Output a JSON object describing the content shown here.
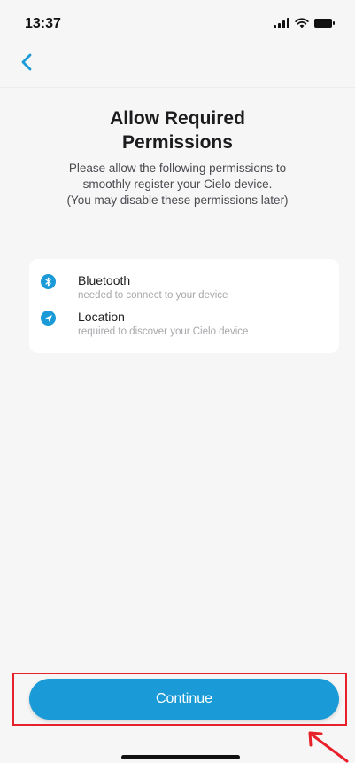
{
  "status_bar": {
    "time": "13:37",
    "icons": [
      "cellular-signal-icon",
      "wifi-icon",
      "battery-icon"
    ]
  },
  "nav": {
    "back_icon": "chevron-left-icon"
  },
  "header": {
    "title_line1": "Allow Required",
    "title_line2": "Permissions",
    "subtitle_line1": "Please allow the following permissions to",
    "subtitle_line2": "smoothly register your Cielo device.",
    "subtitle_line3": "(You may disable these permissions later)"
  },
  "permissions": [
    {
      "icon": "bluetooth-icon",
      "title": "Bluetooth",
      "description": "needed to connect to your device"
    },
    {
      "icon": "location-arrow-icon",
      "title": "Location",
      "description": "required to discover your Cielo device"
    }
  ],
  "footer": {
    "continue_label": "Continue"
  },
  "colors": {
    "accent": "#1a9ad6",
    "background": "#f6f6f7",
    "card": "#ffffff",
    "annotation": "#e8202a"
  }
}
